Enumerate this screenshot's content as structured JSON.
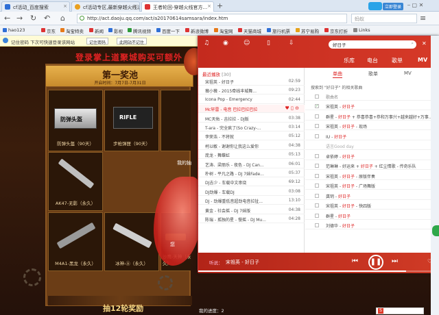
{
  "browser": {
    "tabs": [
      {
        "label": "cf活动_百度搜索",
        "active": false
      },
      {
        "label": "cf活动专区,最新穿越火线活...",
        "active": false
      },
      {
        "label": "王者轮回-穿越火线官方...",
        "active": true
      }
    ],
    "url": "http://act.daoju.qq.com/act/a20170614samsara/index.htm",
    "login_btn": "立即登录",
    "search_placeholder": "蚂蚁",
    "bookmarks": [
      "hao123",
      "京东",
      "淘宝特卖",
      "新闻",
      "影视",
      "腾讯视频",
      "百度一下",
      "新浪微博",
      "淘宝网",
      "天猫商城",
      "旅行机票",
      "苏宁易购",
      "京东打折",
      "Links"
    ],
    "notice": {
      "text": "记住密码 下次可快速登录该网站",
      "btn1": "记住密码",
      "btn2": "此网站不记住"
    }
  },
  "page": {
    "promo": "登录掌上道聚城购买可额外",
    "pool_title": "第一奖池",
    "pool_date": "开启时间：7月7日-7月31日",
    "prizes": [
      {
        "label": "防弹头盔（90天）",
        "icon": "helmet-card",
        "card_text": "防弹头盔"
      },
      {
        "label": "步枪弹匣（90天）",
        "icon": "magazine-card",
        "card_text": "RIFLE"
      },
      {
        "label": "AK47-无影（永久）",
        "icon": "rifle"
      },
      {
        "label": "M4A1-黑龙（永久）",
        "icon": "rifle"
      },
      {
        "label": "冰神-Ⓐ（永久）",
        "icon": "rifle"
      },
      {
        "label": "沙鹰-天神（永久）",
        "icon": "pistol"
      }
    ],
    "mine": "我的抽",
    "gift": "您",
    "bottom_title": "抽12轮奖励",
    "progress": "我的进度：2"
  },
  "player": {
    "search": "好日子",
    "tabs": [
      "乐库",
      "电台",
      "歌单",
      "MV"
    ],
    "subtabs": [
      "单曲",
      "歌单",
      "MV"
    ],
    "recent_label": "最近播放",
    "recent_count": "[30]",
    "result_label": "搜索到 \"好日子\" 的相关歌曲",
    "col_header": "歌曲名",
    "playlist": [
      {
        "title": "宋祖英 - 好日子",
        "time": "02:59",
        "active": false
      },
      {
        "title": "薇小薇 - 2015牵线丰城舞...",
        "time": "09:23"
      },
      {
        "title": "Icona Pop - Emergency",
        "time": "02:44"
      },
      {
        "title": "Mc轩雷 - 电音 巴拉巴拉巴拉",
        "time": "",
        "active": true
      },
      {
        "title": "MC天佑 - 吉拉拉 - DJ版",
        "time": "03:38"
      },
      {
        "title": "T-ara - 完全疯了(So Crazy-...",
        "time": "03:14"
      },
      {
        "title": "李荣浩 - 不将就",
        "time": "05:12"
      },
      {
        "title": "柯以敏 - 谢谢你让我这么爱你",
        "time": "04:38"
      },
      {
        "title": "庞龙 - 舞蝶虹",
        "time": "05:13"
      },
      {
        "title": "艺涛、梁丽乐 - 夜色 - DJ Can...",
        "time": "06:01"
      },
      {
        "title": "朴树 - 平凡之路 - DJ 7妹Fade...",
        "time": "05:37"
      },
      {
        "title": "DJ吉少 - 车载中文串烧",
        "time": "69:12"
      },
      {
        "title": "DJ劲爆 - 车载DJ",
        "time": "03:08"
      },
      {
        "title": "DJ - 劲爆重低音超劲电音拉扯...",
        "time": "13:10"
      },
      {
        "title": "黄金 - 社会摇 - DJ 7妹版",
        "time": "04:38"
      },
      {
        "title": "陈瑞 - 孤独的星 - 慢摇 - DJ Mu...",
        "time": "04:28"
      }
    ],
    "results": [
      {
        "title": "宋祖英 - 好日子",
        "checked": true
      },
      {
        "title": "群星 - 好日子 + 恭喜恭喜+恭和万事兴+越来越好+万事...",
        "checked": false
      },
      {
        "title": "宋祖英 - 好日子 - 现场",
        "checked": false
      },
      {
        "title": "IU - 好日子",
        "checked": false
      },
      {
        "title": "语言Good day",
        "checked": false,
        "sub": true
      },
      {
        "title": "卓依婷 - 好日子",
        "checked": false
      },
      {
        "title": "范琳琳 - 好运来 + 好日子 + 红尘情歌 - 传奇乐队",
        "checked": false
      },
      {
        "title": "宋祖英 - 好日子 - 原版伴奏",
        "checked": false
      },
      {
        "title": "宋祖英 - 好日子 - 广场舞版",
        "checked": false
      },
      {
        "title": "龚玥 - 好日子",
        "checked": false
      },
      {
        "title": "宋祖英 - 好日子 - 快四版",
        "checked": false
      },
      {
        "title": "群星 - 好日子",
        "checked": false
      },
      {
        "title": "刘德华 - 好日子",
        "checked": false
      }
    ],
    "now_playing_prefix": "听说：",
    "now_playing": "宋祖英 - 好日子",
    "progress_fraction": 0.86
  }
}
